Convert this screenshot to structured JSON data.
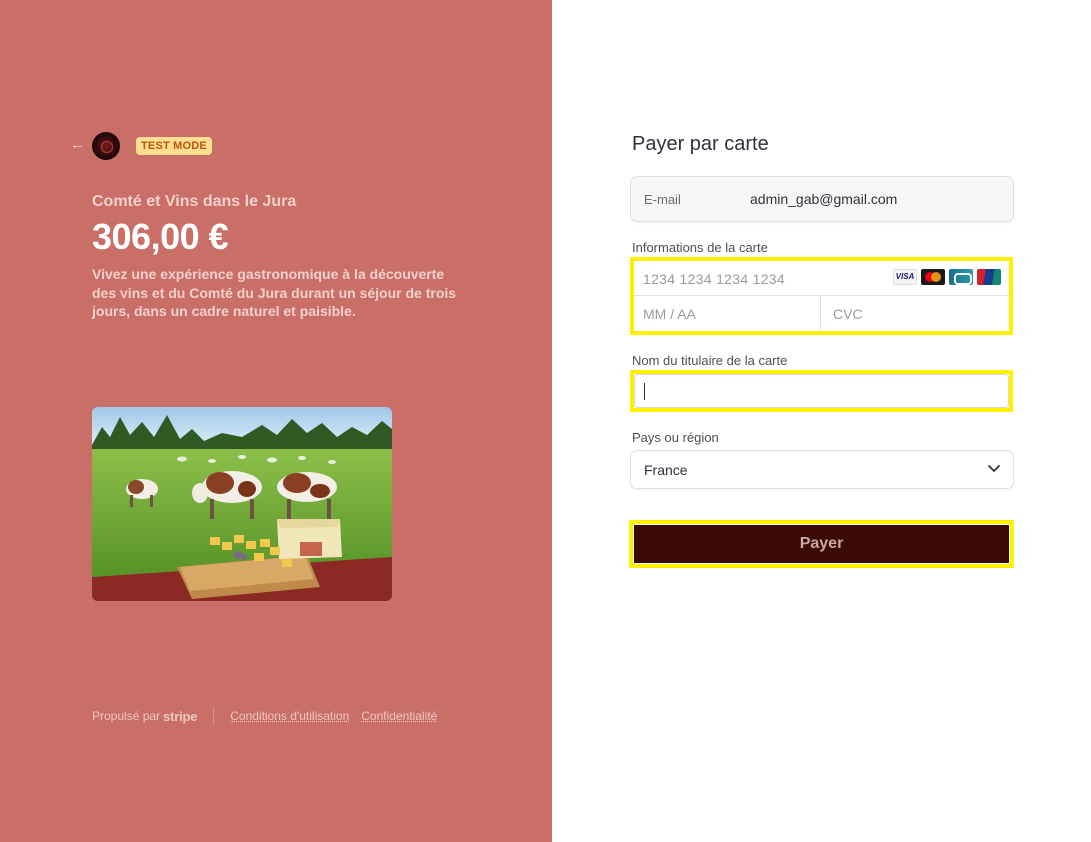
{
  "header": {
    "back_icon": "arrow-left-icon",
    "badge": "TEST MODE"
  },
  "product": {
    "name": "Comté et Vins dans le Jura",
    "price": "306,00 €",
    "description": "Vivez une expérience gastronomique à la découverte des vins et du Comté du Jura durant un séjour de trois jours, dans un cadre naturel et paisible."
  },
  "footer": {
    "powered_by": "Propulsé par",
    "brand": "stripe",
    "terms": "Conditions d'utilisation",
    "privacy": "Confidentialité"
  },
  "form": {
    "title": "Payer par carte",
    "email_label": "E-mail",
    "email_value": "admin_gab@gmail.com",
    "card_label": "Informations de la carte",
    "card_number_placeholder": "1234 1234 1234 1234",
    "expiry_placeholder": "MM / AA",
    "cvc_placeholder": "CVC",
    "card_brands": [
      "VISA",
      "mastercard",
      "CB",
      "UnionPay"
    ],
    "name_label": "Nom du titulaire de la carte",
    "name_value": "",
    "country_label": "Pays ou région",
    "country_value": "France",
    "pay_label": "Payer"
  },
  "colors": {
    "left_panel": "#c96f68",
    "pay_button": "#3c0a06",
    "highlight": "#ffef00",
    "badge_bg": "#ffde92"
  }
}
